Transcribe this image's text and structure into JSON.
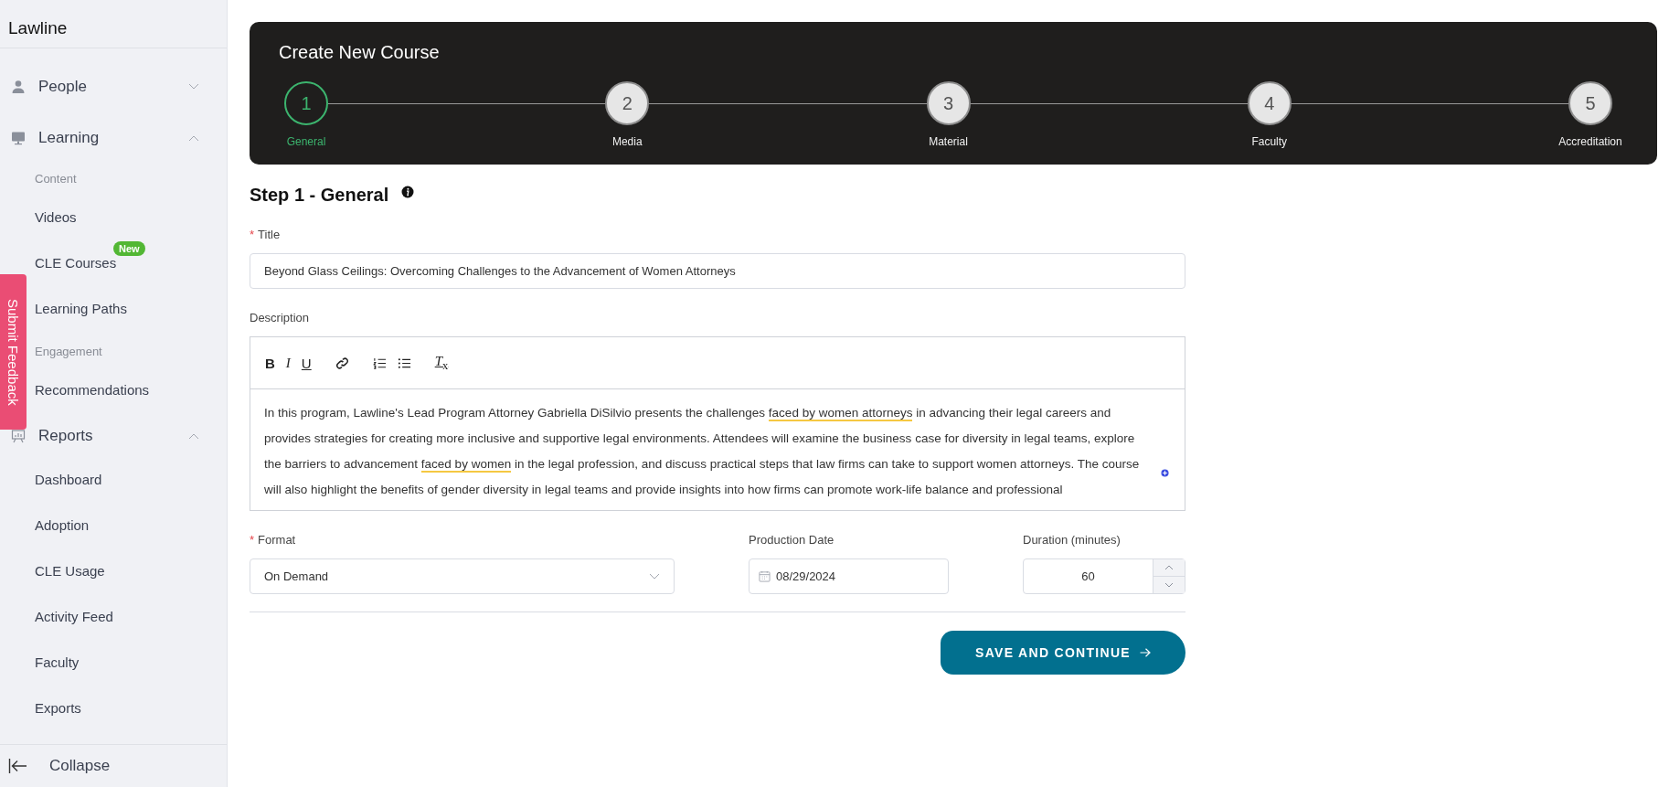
{
  "brand": "Lawline",
  "sidebar": {
    "groups": [
      {
        "label": "People",
        "expanded": false
      },
      {
        "label": "Learning",
        "expanded": true,
        "children": [
          {
            "kind": "heading",
            "label": "Content"
          },
          {
            "kind": "link",
            "label": "Videos"
          },
          {
            "kind": "link",
            "label": "CLE Courses",
            "badge": "New"
          },
          {
            "kind": "link",
            "label": "Learning Paths"
          },
          {
            "kind": "heading",
            "label": "Engagement"
          },
          {
            "kind": "link",
            "label": "Recommendations"
          }
        ]
      },
      {
        "label": "Reports",
        "expanded": true,
        "children": [
          {
            "kind": "link",
            "label": "Dashboard"
          },
          {
            "kind": "link",
            "label": "Adoption"
          },
          {
            "kind": "link",
            "label": "CLE Usage"
          },
          {
            "kind": "link",
            "label": "Activity Feed"
          },
          {
            "kind": "link",
            "label": "Faculty"
          },
          {
            "kind": "link",
            "label": "Exports"
          }
        ]
      }
    ],
    "collapse": "Collapse"
  },
  "feedback_tab": "Submit Feedback",
  "header": {
    "title": "Create New Course",
    "steps": [
      {
        "number": "1",
        "label": "General",
        "selected": true
      },
      {
        "number": "2",
        "label": "Media",
        "selected": false
      },
      {
        "number": "3",
        "label": "Material",
        "selected": false
      },
      {
        "number": "4",
        "label": "Faculty",
        "selected": false
      },
      {
        "number": "5",
        "label": "Accreditation",
        "selected": false
      }
    ]
  },
  "form": {
    "heading": "Step 1 - General",
    "title_field": {
      "label": "Title",
      "required_mark": "*",
      "value": "Beyond Glass Ceilings: Overcoming Challenges to the Advancement of Women Attorneys"
    },
    "description": {
      "label": "Description",
      "toolbar": [
        {
          "kind": "bold",
          "glyph": "B"
        },
        {
          "kind": "italic",
          "glyph": "I"
        },
        {
          "kind": "underline",
          "glyph": "U"
        },
        {
          "kind": "link"
        },
        {
          "kind": "ordered-list"
        },
        {
          "kind": "bullet-list"
        },
        {
          "kind": "clear-format",
          "glyph": "*T*$_{x}$"
        }
      ],
      "segments": [
        {
          "text": "In this program, Lawline's Lead Program Attorney Gabriella DiSilvio presents the challenges ",
          "flagged": false
        },
        {
          "text": "faced by women attorneys",
          "flagged": true
        },
        {
          "text": " in advancing their legal careers and provides strategies for creating more inclusive and supportive legal environments. Attendees will examine the business case for diversity in legal teams, explore the barriers to advancement ",
          "flagged": false
        },
        {
          "text": "faced by women",
          "flagged": true
        },
        {
          "text": " in the legal profession, and discuss practical steps that law firms can take to support women attorneys. The course will also highlight the benefits of gender diversity in legal teams and provide insights into how firms can promote work-life balance and professional",
          "flagged": false
        }
      ]
    },
    "format": {
      "label": "Format",
      "required_mark": "*",
      "value": "On Demand"
    },
    "production_date": {
      "label": "Production Date",
      "value": "08/29/2024"
    },
    "duration": {
      "label": "Duration (minutes)",
      "value": "60"
    },
    "submit": "SAVE AND CONTINUE"
  }
}
